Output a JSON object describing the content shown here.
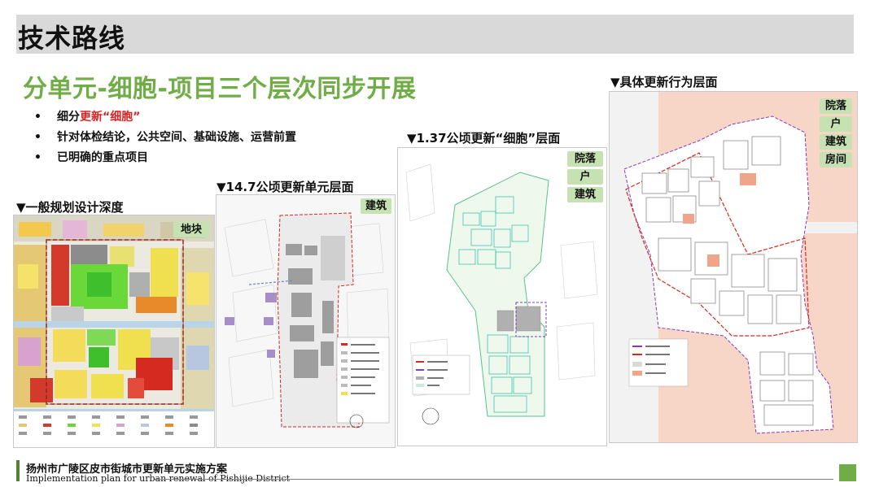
{
  "slide": {
    "title": "技术路线",
    "subtitle": "分单元-细胞-项目三个层次同步开展",
    "bullets": [
      {
        "prefix": "细分",
        "highlight": "更新“细胞”"
      },
      {
        "text": "针对体检结论，公共空间、基础设施、运营前置"
      },
      {
        "text": "已明确的重点项目"
      }
    ]
  },
  "panels": {
    "general": {
      "caption": "▼一般规划设计深度",
      "tags": [
        "地块"
      ]
    },
    "unit": {
      "caption": "▼14.7公顷更新单元层面",
      "tags": [
        "建筑"
      ]
    },
    "cell": {
      "caption": "▼1.37公顷更新“细胞”层面",
      "tags": [
        "院落",
        "户",
        "建筑"
      ]
    },
    "detail": {
      "caption": "▼具体更新行为层面",
      "tags": [
        "院落",
        "户",
        "建筑",
        "房间"
      ]
    }
  },
  "footer": {
    "title": "扬州市广陵区皮市街城市更新单元实施方案",
    "subtitle": "Implementation plan for urban renewal of Pishijie District"
  },
  "colors": {
    "accent_green": "#70ad47",
    "dark_green": "#548235",
    "tag_green": "#c7e2b2",
    "highlight_red": "#e02020"
  }
}
